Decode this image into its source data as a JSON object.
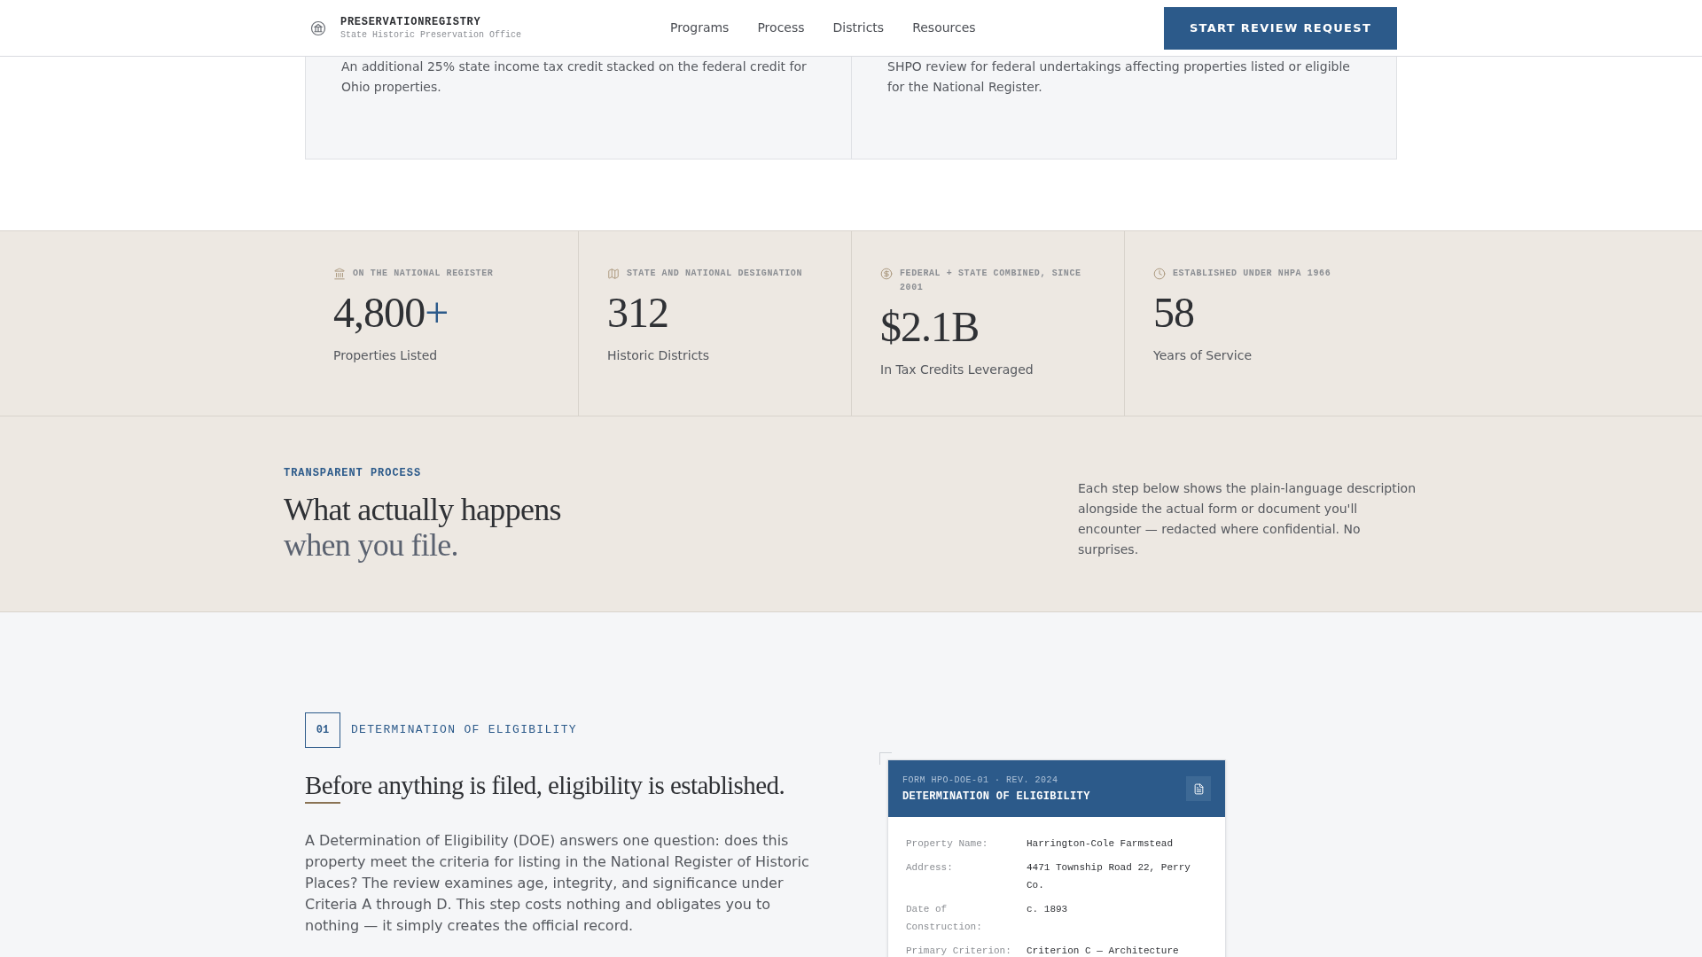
{
  "header": {
    "brand": "PRESERVATIONREGISTRY",
    "subtitle": "State Historic Preservation Office",
    "nav": [
      {
        "label": "Programs"
      },
      {
        "label": "Process"
      },
      {
        "label": "Districts"
      },
      {
        "label": "Resources"
      }
    ],
    "cta": "START REVIEW REQUEST"
  },
  "program_cards": [
    {
      "text": "An additional 25% state income tax credit stacked on the federal credit for Ohio properties."
    },
    {
      "text": "SHPO review for federal undertakings affecting properties listed or eligible for the National Register."
    }
  ],
  "stats": [
    {
      "caption": "ON THE NATIONAL REGISTER",
      "value": "4,800",
      "suffix": "+",
      "label": "Properties Listed"
    },
    {
      "caption": "STATE AND NATIONAL DESIGNATION",
      "value": "312",
      "label": "Historic Districts"
    },
    {
      "caption": "FEDERAL + STATE COMBINED, SINCE 2001",
      "value": "$2.1B",
      "label": "In Tax Credits Leveraged"
    },
    {
      "caption": "ESTABLISHED UNDER NHPA 1966",
      "value": "58",
      "label": "Years of Service"
    }
  ],
  "process": {
    "eyebrow": "TRANSPARENT PROCESS",
    "heading_line_1": "What actually happens",
    "heading_line_2": "when you file.",
    "description": "Each step below shows the plain-language description alongside the actual form or document you'll encounter — redacted where confidential. No surprises."
  },
  "step": {
    "number": "01",
    "label": "DETERMINATION OF ELIGIBILITY",
    "heading": "Before anything is filed, eligibility is established.",
    "body": "A Determination of Eligibility (DOE) answers one question: does this property meet the criteria for listing in the National Register of Historic Places? The review examines age, integrity, and significance under Criteria A through D. This step costs nothing and obligates you to nothing — it simply creates the official record.",
    "form": {
      "form_id": "FORM HPO-DOE-01 · REV. 2024",
      "title": "DETERMINATION OF ELIGIBILITY",
      "fields": [
        {
          "label": "Property Name:",
          "value": "Harrington-Cole Farmstead"
        },
        {
          "label": "Address:",
          "value": "4471 Township Road 22, Perry Co."
        },
        {
          "label": "Date of Construction:",
          "value": "c. 1893"
        },
        {
          "label": "Primary Criterion:",
          "value": "Criterion C — Architecture"
        }
      ]
    }
  }
}
